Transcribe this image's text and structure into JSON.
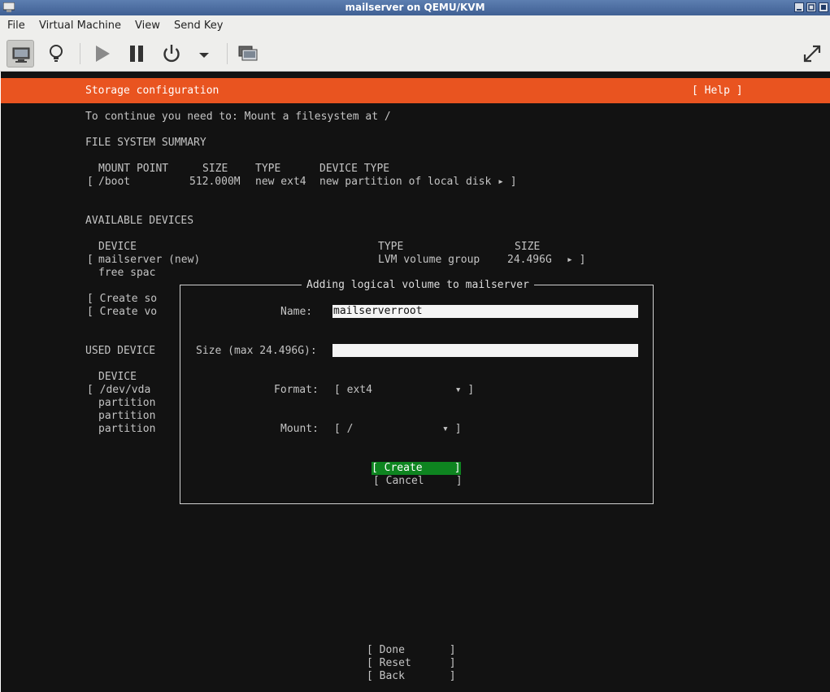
{
  "window": {
    "title": "mailserver on QEMU/KVM"
  },
  "menu": {
    "items": [
      "File",
      "Virtual Machine",
      "View",
      "Send Key"
    ]
  },
  "installer": {
    "header": {
      "title": "Storage configuration",
      "help": "[ Help ]"
    },
    "notice": "To continue you need to: Mount a filesystem at /",
    "fs_summary": {
      "heading": "FILE SYSTEM SUMMARY",
      "columns": [
        "MOUNT POINT",
        "SIZE",
        "TYPE",
        "DEVICE TYPE"
      ],
      "row": {
        "bracket": "[",
        "mount": "/boot",
        "size": "512.000M",
        "type": "new ext4",
        "device_type": "new partition of local disk ▸ ]"
      }
    },
    "available": {
      "heading": "AVAILABLE DEVICES",
      "columns": [
        "DEVICE",
        "TYPE",
        "SIZE"
      ],
      "row": {
        "bracket": "[",
        "device": "mailserver (new)",
        "type": "LVM volume group",
        "size": "24.496G",
        "arrow": "▸ ]"
      },
      "free": "free spac",
      "action1": "[ Create so",
      "action2": "[ Create vo"
    },
    "used": {
      "heading": "USED DEVICE",
      "column": "DEVICE",
      "row": "[ /dev/vda",
      "parts": [
        "partition",
        "partition",
        "partition"
      ]
    },
    "bottom_buttons": {
      "done": "[ Done       ]",
      "reset": "[ Reset      ]",
      "back": "[ Back       ]"
    }
  },
  "dialog": {
    "title": "Adding logical volume to mailserver",
    "name_label": "Name:",
    "name_value": "mailserverroot",
    "size_label": "Size (max 24.496G):",
    "size_value": "",
    "format_label": "Format:",
    "format_value": "[ ext4             ▾ ]",
    "mount_label": "Mount:",
    "mount_value": "[ /              ▾ ]",
    "create": "[ Create     ]",
    "cancel": "[ Cancel     ]"
  },
  "icons": {
    "console": "monitor-icon",
    "details": "lightbulb-icon",
    "run": "play-icon",
    "pause": "pause-icon",
    "shutdown": "power-icon",
    "shutdown_menu": "dropdown-arrow-icon",
    "snapshots": "snapshot-icon",
    "fullscreen": "fullscreen-icon"
  },
  "colors": {
    "header": "#e95420",
    "create_button": "#0e8420",
    "console_bg": "#121212"
  }
}
